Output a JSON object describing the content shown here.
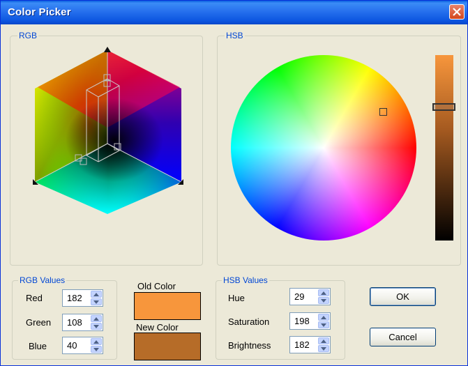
{
  "window": {
    "title": "Color Picker"
  },
  "rgb_panel": {
    "legend": "RGB"
  },
  "hsb_panel": {
    "legend": "HSB"
  },
  "rgb_values": {
    "legend": "RGB Values",
    "red_label": "Red",
    "red": "182",
    "green_label": "Green",
    "green": "108",
    "blue_label": "Blue",
    "blue": "40"
  },
  "swatches": {
    "old_label": "Old Color",
    "old_color": "#f7963c",
    "new_label": "New Color",
    "new_color": "#b66c28"
  },
  "hsb_values": {
    "legend": "HSB Values",
    "hue_label": "Hue",
    "hue": "29",
    "saturation_label": "Saturation",
    "saturation": "198",
    "brightness_label": "Brightness",
    "brightness": "182"
  },
  "buttons": {
    "ok": "OK",
    "cancel": "Cancel"
  },
  "icons": {
    "close": "close-icon",
    "spin_up": "arrow-up-icon",
    "spin_down": "arrow-down-icon"
  },
  "brightness_slider": {
    "value_fraction": 0.714
  }
}
